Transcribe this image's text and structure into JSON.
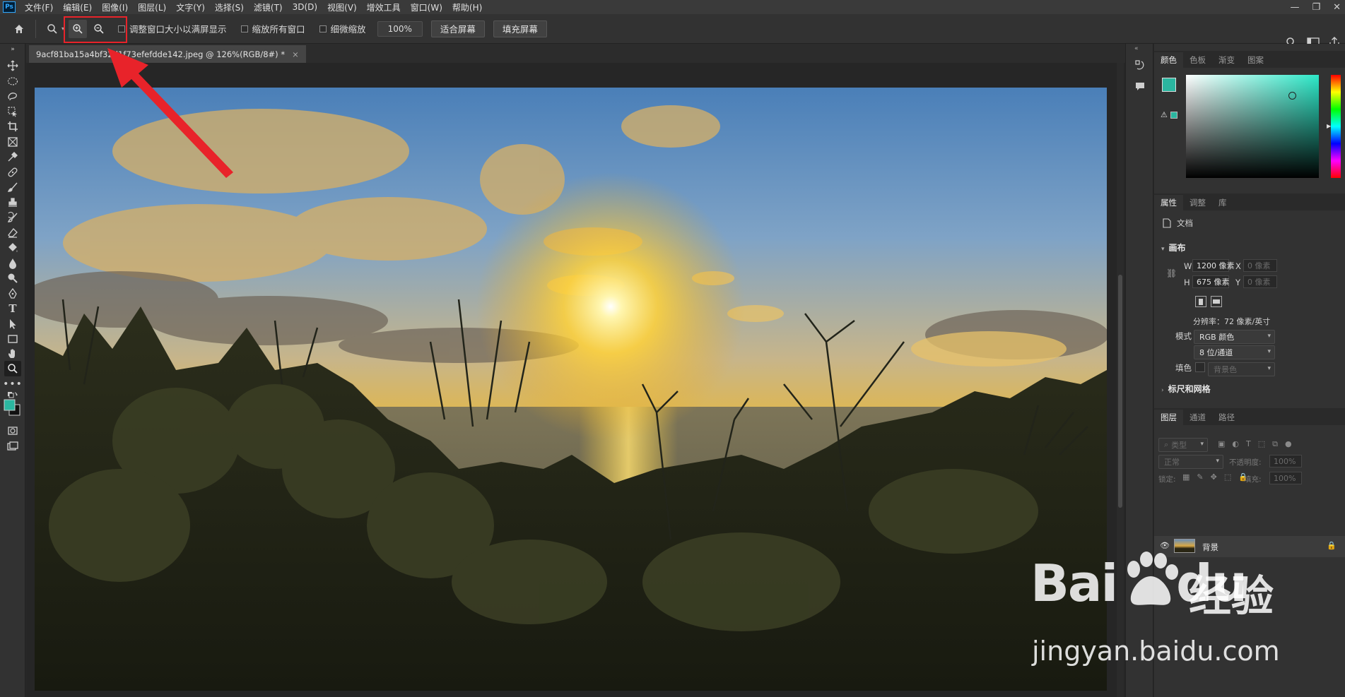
{
  "app": {
    "logo": "Ps"
  },
  "menu": [
    "文件(F)",
    "编辑(E)",
    "图像(I)",
    "图层(L)",
    "文字(Y)",
    "选择(S)",
    "滤镜(T)",
    "3D(D)",
    "视图(V)",
    "增效工具",
    "窗口(W)",
    "帮助(H)"
  ],
  "window_controls": {
    "minimize": "—",
    "restore": "❐",
    "close": "✕"
  },
  "options": {
    "resize_windows_label": "调整窗口大小以满屏显示",
    "zoom_all_windows_label": "缩放所有窗口",
    "scrubby_zoom_label": "细微缩放",
    "zoom_value": "100%",
    "fit_screen_label": "适合屏幕",
    "fill_screen_label": "填充屏幕"
  },
  "document": {
    "tab_title": "9acf81ba15a4bf32d1f73efefdde142.jpeg @ 126%(RGB/8#) *",
    "tab_close": "×"
  },
  "panels": {
    "color_tabs": [
      "颜色",
      "色板",
      "渐变",
      "图案"
    ],
    "props_tabs": [
      "属性",
      "调整",
      "库"
    ],
    "layers_tabs": [
      "图层",
      "通道",
      "路径"
    ]
  },
  "properties": {
    "doc_label": "文档",
    "canvas_title": "画布",
    "w_label": "W",
    "w_value": "1200 像素",
    "x_label": "X",
    "x_value": "0 像素",
    "h_label": "H",
    "h_value": "675 像素",
    "y_label": "Y",
    "y_value": "0 像素",
    "resolution": "分辨率：72 像素/英寸",
    "mode_label": "模式",
    "mode_value": "RGB 颜色",
    "depth_value": "8 位/通道",
    "fill_label": "填色",
    "fill_value": "背景色",
    "rulers_title": "标尺和网格"
  },
  "layers": {
    "filter_placeholder": "类型",
    "blend_mode": "正常",
    "opacity_label": "不透明度:",
    "opacity_value": "100%",
    "lock_label": "锁定:",
    "fill_label": "填充:",
    "fill_value": "100%",
    "layer_name": "背景"
  },
  "colors": {
    "foreground": "#2bb6a0",
    "background": "#111111",
    "highlight": "#e8232a"
  },
  "watermark": {
    "brand": "Bai",
    "brand2": "du",
    "cn": "经验",
    "url": "jingyan.baidu.com"
  }
}
